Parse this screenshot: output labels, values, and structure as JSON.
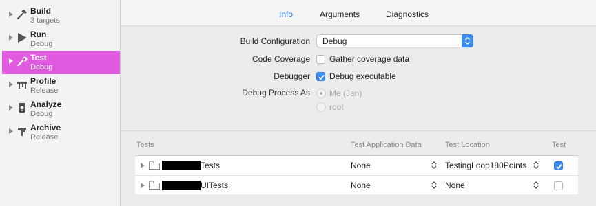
{
  "sidebar": {
    "items": [
      {
        "title": "Build",
        "subtitle": "3 targets",
        "icon": "hammer-icon"
      },
      {
        "title": "Run",
        "subtitle": "Debug",
        "icon": "play-icon"
      },
      {
        "title": "Test",
        "subtitle": "Debug",
        "icon": "wrench-icon",
        "selected": true
      },
      {
        "title": "Profile",
        "subtitle": "Release",
        "icon": "instruments-icon"
      },
      {
        "title": "Analyze",
        "subtitle": "Debug",
        "icon": "analyze-icon"
      },
      {
        "title": "Archive",
        "subtitle": "Release",
        "icon": "archive-icon"
      }
    ],
    "selected_color": "#e05be0"
  },
  "tabs": [
    {
      "label": "Info",
      "active": true
    },
    {
      "label": "Arguments",
      "active": false
    },
    {
      "label": "Diagnostics",
      "active": false
    }
  ],
  "accent_color": "#2a7ae2",
  "form": {
    "build_configuration_label": "Build Configuration",
    "build_configuration_value": "Debug",
    "code_coverage_label": "Code Coverage",
    "code_coverage_text": "Gather coverage data",
    "code_coverage_checked": false,
    "debugger_label": "Debugger",
    "debugger_text": "Debug executable",
    "debugger_checked": true,
    "debug_process_label": "Debug Process As",
    "radio_me": "Me (Jan)",
    "radio_root": "root",
    "radio_me_selected": true
  },
  "table": {
    "headers": [
      "Tests",
      "Test Application Data",
      "Test Location",
      "Test"
    ],
    "rows": [
      {
        "name_suffix": "Tests",
        "app_data": "None",
        "location": "TestingLoop180Points",
        "enabled": true
      },
      {
        "name_suffix": "UITests",
        "app_data": "None",
        "location": "None",
        "enabled": false
      }
    ]
  }
}
